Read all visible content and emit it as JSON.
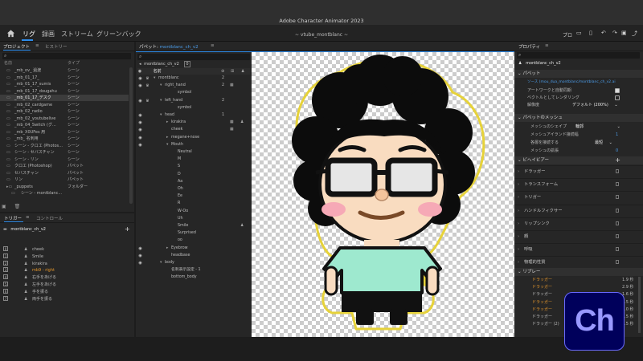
{
  "app": {
    "title": "Adobe Character Animator 2023"
  },
  "workspace": {
    "tabs": [
      "リグ",
      "録画",
      "ストリーム",
      "グリーンバック"
    ],
    "active_tab": "リグ",
    "center_label": "~ vtube_montblanc ~",
    "right_label": "プロ"
  },
  "project": {
    "tabs": [
      "プロジェクト",
      "ヒストリー"
    ],
    "header_name": "名前",
    "header_type": "タイプ",
    "items": [
      {
        "name": "_mb_ov_ 過渡",
        "type": "シーン"
      },
      {
        "name": "_mb_01_17_",
        "type": "シーン"
      },
      {
        "name": "_mb_01_17_sumis",
        "type": "シーン"
      },
      {
        "name": "_mb_01_17_dougahu",
        "type": "シーン"
      },
      {
        "name": "_mb_01_17_デスク",
        "type": "シーン"
      },
      {
        "name": "_mb_02_cardgame",
        "type": "シーン"
      },
      {
        "name": "_mb_02_radio",
        "type": "シーン"
      },
      {
        "name": "_mb_02_youtubelive",
        "type": "シーン"
      },
      {
        "name": "_mb_04_Switch (グ...",
        "type": "シーン"
      },
      {
        "name": "_mb_X0UFes 用",
        "type": "シーン"
      },
      {
        "name": "_mb_ 名刺用",
        "type": "シーン"
      },
      {
        "name": "シーン - クロエ (Photos...",
        "type": "シーン"
      },
      {
        "name": "シーン - セバスチャン",
        "type": "シーン"
      },
      {
        "name": "シーン - リン",
        "type": "シーン"
      },
      {
        "name": "クロエ (Photoshop)",
        "type": "パペット"
      },
      {
        "name": "セバスチャン",
        "type": "パペット"
      },
      {
        "name": "リン",
        "type": "パペット"
      },
      {
        "name": "_puppets",
        "type": "フォルダー"
      },
      {
        "name": "シーン - montblanc...",
        "type": ""
      }
    ]
  },
  "triggers": {
    "tabs": [
      "トリガー",
      "コントロール"
    ],
    "puppet": "montblanc_ch_v2",
    "items": [
      {
        "key": "0",
        "name": "cheek"
      },
      {
        "key": "1",
        "name": "Smile"
      },
      {
        "key": "2",
        "name": "kirakira"
      },
      {
        "key": "3",
        "name": "mb9 - right"
      },
      {
        "key": "4",
        "name": "右手をあげる"
      },
      {
        "key": "5",
        "name": "左手をあげる"
      },
      {
        "key": "6",
        "name": "手を振る"
      },
      {
        "key": "7",
        "name": "両手を振る"
      }
    ]
  },
  "puppet_panel": {
    "tab_label": "パペット",
    "tab_target": "montblanc_ch_v2",
    "subtab": "montblanc_ch_v2",
    "subtab_count": "0",
    "header_name": "名前",
    "layers": [
      {
        "name": "montblanc",
        "num": "2",
        "indent": 0
      },
      {
        "name": "right_hand",
        "num": "2",
        "indent": 1
      },
      {
        "name": "symbol",
        "num": "",
        "indent": 3
      },
      {
        "name": "left_hand",
        "num": "2",
        "indent": 1
      },
      {
        "name": "symbol",
        "num": "",
        "indent": 3
      },
      {
        "name": "head",
        "num": "1",
        "indent": 1
      },
      {
        "name": "kirakira",
        "num": "",
        "indent": 2
      },
      {
        "name": "cheek",
        "num": "",
        "indent": 2
      },
      {
        "name": "megane+nose",
        "num": "",
        "indent": 2
      },
      {
        "name": "Mouth",
        "num": "",
        "indent": 2
      },
      {
        "name": "Neutral",
        "num": "",
        "indent": 3
      },
      {
        "name": "M",
        "num": "",
        "indent": 3
      },
      {
        "name": "S",
        "num": "",
        "indent": 3
      },
      {
        "name": "D",
        "num": "",
        "indent": 3
      },
      {
        "name": "Aa",
        "num": "",
        "indent": 3
      },
      {
        "name": "Oh",
        "num": "",
        "indent": 3
      },
      {
        "name": "Ee",
        "num": "",
        "indent": 3
      },
      {
        "name": "R",
        "num": "",
        "indent": 3
      },
      {
        "name": "W-Oo",
        "num": "",
        "indent": 3
      },
      {
        "name": "Uh",
        "num": "",
        "indent": 3
      },
      {
        "name": "Smile",
        "num": "",
        "indent": 3
      },
      {
        "name": "Surprised",
        "num": "",
        "indent": 3
      },
      {
        "name": "oo",
        "num": "",
        "indent": 3
      },
      {
        "name": "Eyebrow",
        "num": "",
        "indent": 2
      },
      {
        "name": "headbase",
        "num": "",
        "indent": 2
      },
      {
        "name": "body",
        "num": "",
        "indent": 1
      },
      {
        "name": "名刺表示設定 - 1",
        "num": "",
        "indent": 2
      },
      {
        "name": "bottom_body",
        "num": "",
        "indent": 2
      }
    ]
  },
  "properties": {
    "tab_label": "プロパティ",
    "puppet_name": "montblanc_ch_v2",
    "puppet_section": "パペット",
    "source": "ソース (mou_dua_montblanc/montblanc_ch_v2.ai",
    "auto_artwork": "アートワークと自動同期",
    "vector_render": "ベクトルとしてレンダリング",
    "resolution_label": "解像度",
    "resolution_value": "デフォルト (200%)",
    "mesh_section": "パペットのメッシュ",
    "mesh_shape_label": "メッシュのシェイプ",
    "mesh_shape_value": "輪郭",
    "mesh_contour_label": "メッシュアイランド接続幅",
    "mesh_contour_value": "1",
    "mesh_connect_label": "各層を接続する",
    "mesh_connect_value": "最短",
    "mesh_spacing_label": "メッシュの拡張",
    "mesh_spacing_value": "0",
    "behavior_section": "ビヘイビアー",
    "behaviors": [
      "ドラッガー",
      "トランスフォーム",
      "トリガー",
      "ハンドルフィクサー",
      "リップシンク",
      "顔",
      "呼吸",
      "物理的性質"
    ],
    "replay_section": "リプレー",
    "replays": [
      {
        "name": "ドラッガー",
        "time": "1.9 秒"
      },
      {
        "name": "ドラッガー",
        "time": "2.9 秒"
      },
      {
        "name": "ドラッガー",
        "time": "1.6 秒"
      },
      {
        "name": "ドラッガー",
        "time": "1.5 秒"
      },
      {
        "name": "ドラッガー",
        "time": "1.0 秒"
      },
      {
        "name": "ドラッガー",
        "time": "1.5 秒"
      },
      {
        "name": "ドラッガー (2)",
        "time": "1.5 秒"
      }
    ]
  },
  "logo": "Ch",
  "colors": {
    "accent": "#2d8ceb",
    "orange": "#e3962c",
    "logo_bg": "#00005b",
    "logo_fg": "#9999ff",
    "shirt": "#9ee9cf",
    "selection_outline": "#e6d23a"
  }
}
